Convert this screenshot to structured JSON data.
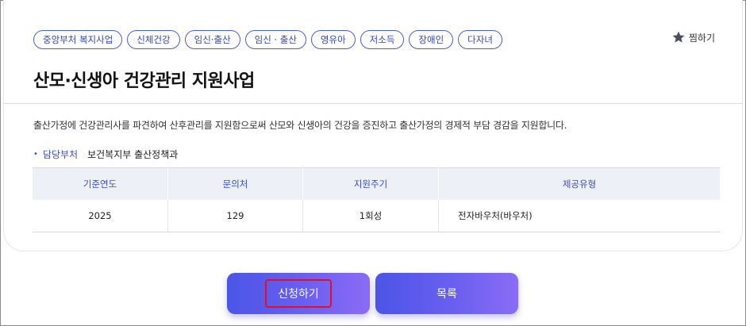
{
  "tags": [
    "중앙부처 복지사업",
    "신체건강",
    "임신·출산",
    "임신 · 출산",
    "영유아",
    "저소득",
    "장애인",
    "다자녀"
  ],
  "favorite": {
    "label": "찜하기",
    "icon": "star-icon"
  },
  "title": "산모·신생아 건강관리 지원사업",
  "description": "출산가정에 건강관리사를 파견하여 산후관리를 지원함으로써 산모와 신생아의 건강을 증진하고 출산가정의 경제적 부담 경감을 지원합니다.",
  "department": {
    "label": "담당부처",
    "value": "보건복지부 출산정책과"
  },
  "table": {
    "headers": [
      "기준연도",
      "문의처",
      "지원주기",
      "제공유형"
    ],
    "row": [
      "2025",
      "129",
      "1회성",
      "전자바우처(바우처)"
    ]
  },
  "buttons": {
    "apply": "신청하기",
    "list": "목록"
  },
  "colors": {
    "accent": "#3a4fc0",
    "highlight": "#e0102a"
  }
}
